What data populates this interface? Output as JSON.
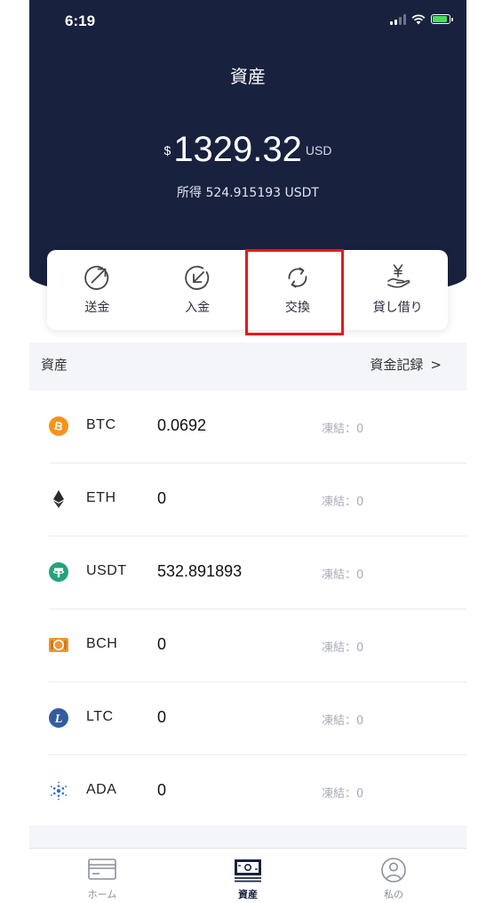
{
  "status_bar": {
    "time": "6:19"
  },
  "header": {
    "title": "資産",
    "currency_symbol": "$",
    "balance": "1329.32",
    "balance_currency": "USD",
    "income_text": "所得 524.915193 USDT"
  },
  "actions": [
    {
      "label": "送金",
      "icon": "send-arrow-icon"
    },
    {
      "label": "入金",
      "icon": "receive-arrow-icon"
    },
    {
      "label": "交換",
      "icon": "exchange-cycle-icon"
    },
    {
      "label": "貸し借り",
      "icon": "lending-yen-hand-icon"
    }
  ],
  "assets_section": {
    "title": "資産",
    "link_label": "資金記録",
    "link_chevron": ">"
  },
  "assets": [
    {
      "symbol": "BTC",
      "amount": "0.0692",
      "frozen": "凍結：0",
      "icon": "btc-icon",
      "color": "#f7931a"
    },
    {
      "symbol": "ETH",
      "amount": "0",
      "frozen": "凍結：0",
      "icon": "eth-icon",
      "color": "#3c3c3d"
    },
    {
      "symbol": "USDT",
      "amount": "532.891893",
      "frozen": "凍結：0",
      "icon": "usdt-icon",
      "color": "#26a17b"
    },
    {
      "symbol": "BCH",
      "amount": "0",
      "frozen": "凍結：0",
      "icon": "bch-icon",
      "color": "#f0942f"
    },
    {
      "symbol": "LTC",
      "amount": "0",
      "frozen": "凍結：0",
      "icon": "ltc-icon",
      "color": "#345d9d"
    },
    {
      "symbol": "ADA",
      "amount": "0",
      "frozen": "凍結：0",
      "icon": "ada-icon",
      "color": "#3468d1"
    }
  ],
  "tabbar": [
    {
      "label": "ホーム",
      "icon": "home-card-icon",
      "active": false
    },
    {
      "label": "資産",
      "icon": "assets-wallet-icon",
      "active": true
    },
    {
      "label": "私の",
      "icon": "profile-icon",
      "active": false
    }
  ],
  "colors": {
    "header_bg": "#18223f",
    "highlight": "#e8161b"
  }
}
